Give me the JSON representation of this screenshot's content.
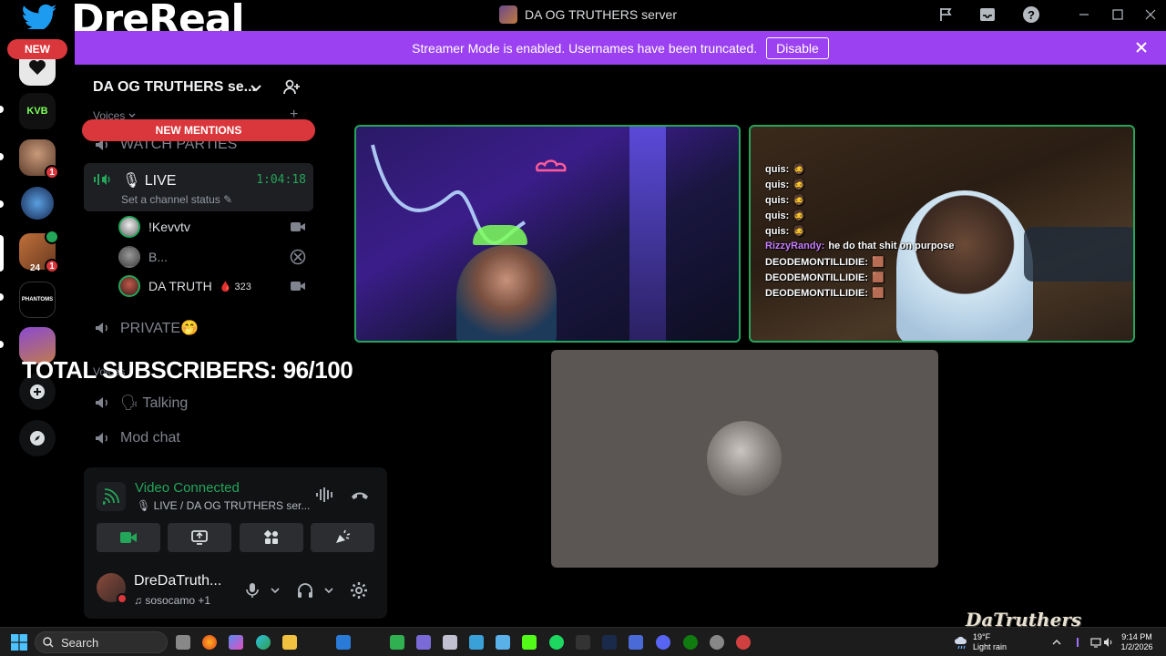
{
  "window": {
    "title": "DA OG TRUTHERS server"
  },
  "overlay": {
    "brand_name": "DreReal",
    "new_badge": "NEW",
    "subscribers": "TOTAL SUBSCRIBERS: 96/100",
    "watermark": "DaTruthers"
  },
  "banner": {
    "text": "Streamer Mode is enabled. Usernames have been truncated.",
    "disable_label": "Disable"
  },
  "rail": {
    "servers": [
      {
        "name": "server-1",
        "color": "#e8e8e8"
      },
      {
        "name": "KVB",
        "label": "KVB",
        "color": "#111"
      },
      {
        "name": "server-3",
        "mentions": "1"
      },
      {
        "name": "server-4"
      },
      {
        "name": "server-5",
        "count": "24",
        "mentions": "1"
      },
      {
        "name": "PHANTOMS",
        "label": "PHANTOMS"
      },
      {
        "name": "server-7"
      }
    ]
  },
  "sidebar": {
    "server_name": "DA OG TRUTHERS se...",
    "category_voices": "Voices",
    "new_mentions": "NEW MENTIONS",
    "channels": {
      "watch_parties": "WATCH PARTIES",
      "live": "🎙 LIVE",
      "live_timer": "1:04:18",
      "live_status": "Set a channel status",
      "private": "PRIVATE🤭",
      "category_voices2": "Voices",
      "talking": "🗣 Talking",
      "mod_chat": "Mod chat"
    },
    "members": [
      {
        "name": "!Kevvtv",
        "icon": "video-icon"
      },
      {
        "name": "B...",
        "icon": "xbox-icon"
      },
      {
        "name": "DA TRUTH",
        "badge": "🩸 323",
        "icon": "video-icon"
      }
    ]
  },
  "voice": {
    "title": "Video Connected",
    "subtitle": "🎙 LIVE / DA OG TRUTHERS ser..."
  },
  "user": {
    "name": "DreDaTruth...",
    "status": "♫ sosocamo +1"
  },
  "stream_chat": [
    {
      "user": "quis:",
      "msg": "🧔"
    },
    {
      "user": "quis:",
      "msg": "🧔"
    },
    {
      "user": "quis:",
      "msg": "🧔"
    },
    {
      "user": "quis:",
      "msg": "🧔"
    },
    {
      "user": "quis:",
      "msg": "🧔"
    },
    {
      "user": "RizzyRandy:",
      "msg": "he do that shit on purpose"
    },
    {
      "user": "DEODEMONTILLIDIE:",
      "msg": "🟫"
    },
    {
      "user": "DEODEMONTILLIDIE:",
      "msg": "🟫"
    },
    {
      "user": "DEODEMONTILLIDIE:",
      "msg": "🟫"
    }
  ],
  "taskbar": {
    "search_label": "Search",
    "weather_temp": "19°F",
    "weather_desc": "Light rain",
    "time": "9:14 PM",
    "date": "1/2/2026"
  },
  "colors": {
    "accent_green": "#23a55a",
    "banner_purple": "#9b41f2",
    "mention_red": "#da373c"
  }
}
